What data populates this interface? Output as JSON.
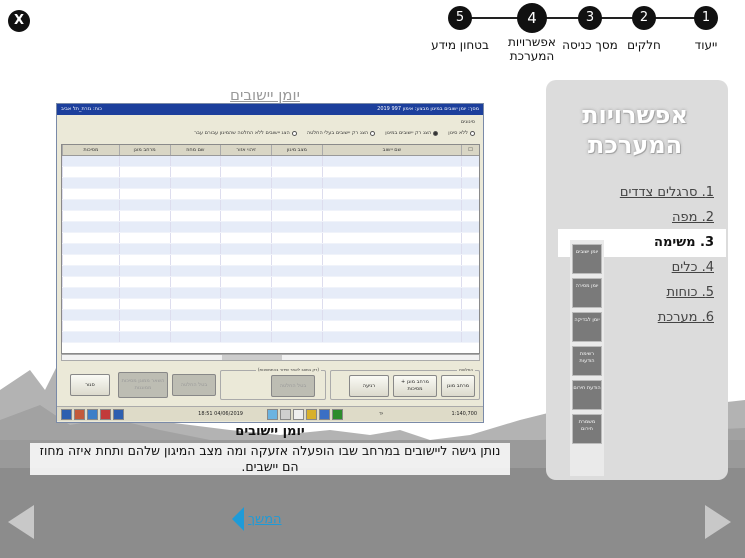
{
  "close_label": "X",
  "steps": [
    {
      "number": "1",
      "label": "ייעוד"
    },
    {
      "number": "2",
      "label": "חלקים"
    },
    {
      "number": "3",
      "label": "מסך כניסה"
    },
    {
      "number": "4",
      "label": "אפשרויות המערכת",
      "active": true
    },
    {
      "number": "5",
      "label": "בטחון מידע"
    }
  ],
  "sidebar": {
    "title": "אפשרויות המערכת",
    "items": [
      {
        "label": "1. סרגלים צדדים"
      },
      {
        "label": "2. מפה"
      },
      {
        "label": "3. משימה",
        "active": true
      },
      {
        "label": "4. כלים"
      },
      {
        "label": "5. כוחות"
      },
      {
        "label": "6. מערכת"
      }
    ],
    "thumbs": [
      "יומן ישובים",
      "יומן מסירה",
      "יומן לבדיקה",
      "רשימת הודעות",
      "הודעת חירום",
      "משמרת חירום"
    ]
  },
  "content_title": "יומן יישובים",
  "app": {
    "title_left": "כוח: גזרת_תל אביב",
    "title_right": "מסך: יומן ישובים במיגון    מבצע: אימון 997 2019",
    "filter_group_label": "סינונים",
    "filters": [
      {
        "label": "ללא סינון",
        "selected": false
      },
      {
        "label": "הצג רק יישובים במיגון",
        "selected": true
      },
      {
        "label": "הצג רק יישובים בעלי החלטה",
        "selected": false
      },
      {
        "label": "הצג יישובים ללא החלטה שהמיגון עבורם עבר",
        "selected": false
      }
    ],
    "columns": [
      "שם יישוב",
      "מצב מיגון",
      "זיהוי אזור",
      "שם מחוז",
      "מרחב מוגן",
      "מסיכות"
    ],
    "buttons": {
      "protected_area": "מרחב מוגן",
      "protected_area_masks": "מרחב מוגן + מסיכות",
      "routine": "רגיעה",
      "group_label": "(רק במצב לאחר שידור בהתמשכות)",
      "cancel_decision": "בטל החלטה",
      "cancel_decision2": "בטל החלטה",
      "alarm_protected": "השאר ממוגן מסיכות ממוגנות",
      "close": "סגור",
      "status_group_label": "החלטות"
    },
    "status": {
      "date": "04/06/2019 18:51",
      "scale": "1:140,700",
      "code": "יד"
    }
  },
  "caption": {
    "title": "יומן יישובים",
    "text": "נותן גישה ליישובים במרחב שבו הופעלה אזעקה ומה מצב המיגון שלהם ותחת איזה מחוז הם יישבים."
  },
  "nav": {
    "continue_label": "המשך"
  },
  "colors": {
    "accent": "#1e9bd8",
    "app_title_bar": "#1c3f9c",
    "panel": "#dcdcdc"
  }
}
